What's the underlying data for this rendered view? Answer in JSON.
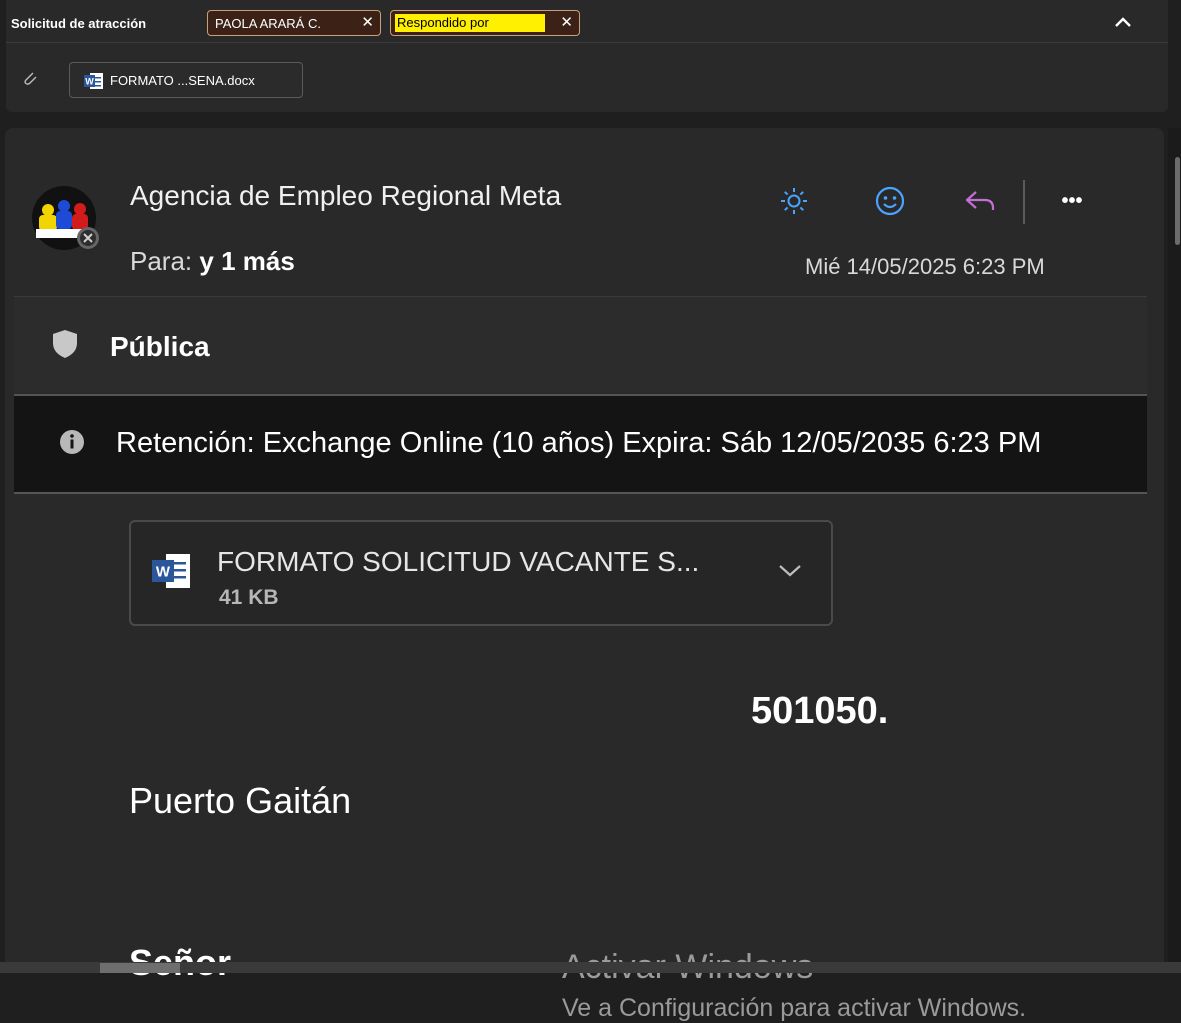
{
  "header": {
    "subject": "Solicitud de atracción",
    "tags": [
      {
        "label": "PAOLA ARARÁ C.",
        "close": "✕"
      },
      {
        "label": "Respondido por",
        "close": "✕"
      }
    ],
    "attachment_chip": "FORMATO ...SENA.docx"
  },
  "message": {
    "sender": "Agencia de Empleo Regional Meta",
    "to_label": "Para:",
    "to_value": "y 1 más",
    "date": "Mié 14/05/2025 6:23 PM",
    "actions": [
      "sun-icon",
      "smiley-icon",
      "reply-icon",
      "more-icon"
    ],
    "more_label": "•••",
    "sensitivity": "Pública",
    "retention": "Retención: Exchange Online (10 años) Expira: Sáb 12/05/2035 6:23 PM",
    "attachment": {
      "name": "FORMATO SOLICITUD VACANTE S...",
      "size": "41 KB"
    },
    "body": {
      "number": "501050.",
      "city": "Puerto Gaitán",
      "greeting": "Señor"
    }
  },
  "watermark": {
    "title": "Activar Windows",
    "subtitle": "Ve a Configuración para activar Windows."
  },
  "colors": {
    "background": "#1f1f1f",
    "panel": "#292929",
    "accent_blue": "#4aa3ff",
    "reply_purple": "#c46fd6",
    "tag_highlight": "#ffef00"
  }
}
